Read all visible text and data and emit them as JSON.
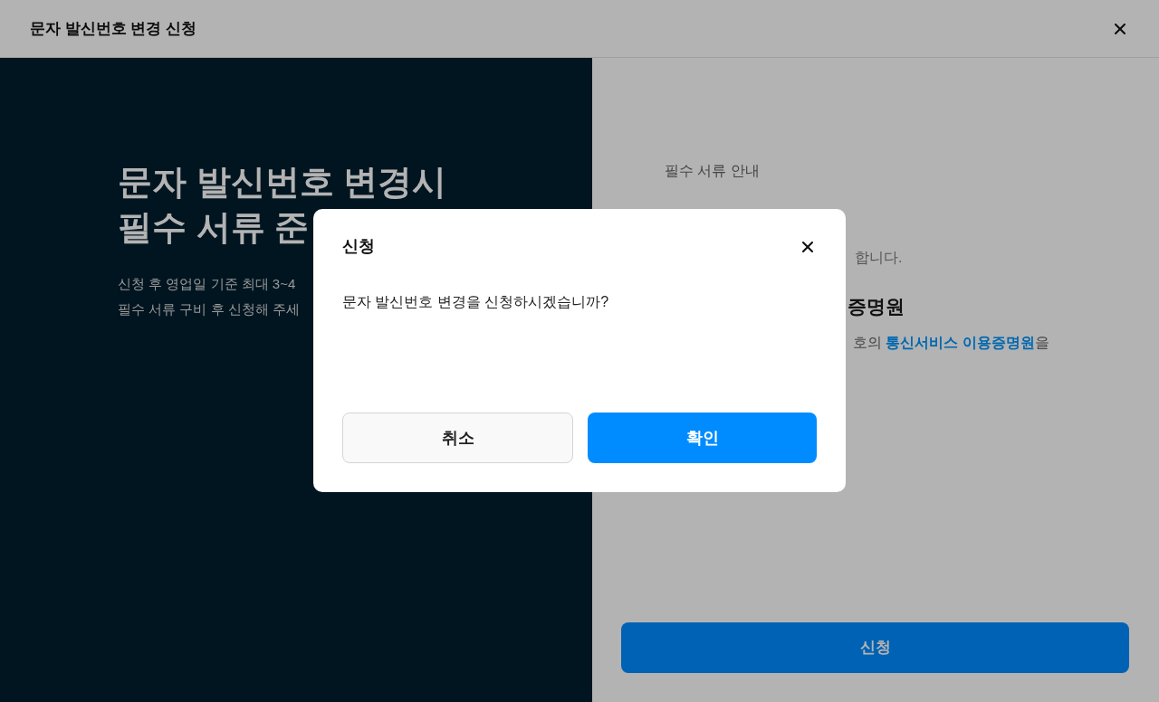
{
  "window": {
    "title": "문자 발신번호 변경 신청"
  },
  "intro": {
    "heading_lines": [
      "문자 발신번호 변경시",
      "필수 서류 준"
    ],
    "description_lines": [
      "신청 후 영업일 기준 최대 3~4",
      "필수 서류 구비 후 신청해 주세"
    ]
  },
  "documents": {
    "heading": "필수 서류 안내",
    "note": "합니다.",
    "item_title": "증명원",
    "item_text": {
      "before": "호의 ",
      "link": "통신서비스 이용증명원",
      "after": "을"
    }
  },
  "submit_button": "신청",
  "dialog": {
    "title": "신청",
    "message": "문자 발신번호 변경을 신청하시겠습니까?",
    "buttons": [
      {
        "label": "취소",
        "kind": "secondary"
      },
      {
        "label": "확인",
        "kind": "primary"
      }
    ]
  }
}
